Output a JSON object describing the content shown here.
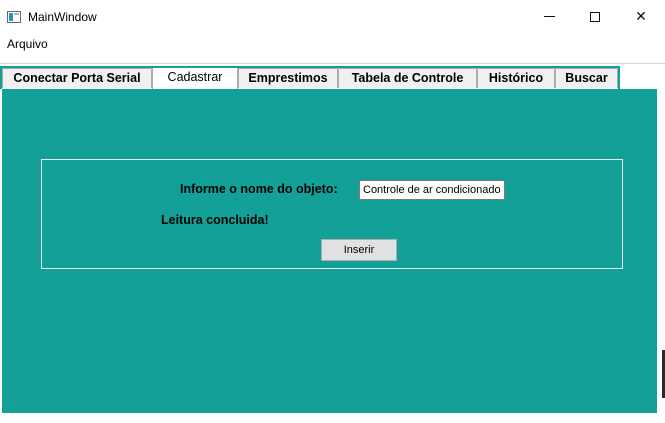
{
  "window": {
    "title": "MainWindow",
    "icon": "app-window-icon",
    "controls": {
      "minimize": "minimize-icon",
      "maximize": "maximize-icon",
      "close_glyph": "✕"
    }
  },
  "menu": {
    "items": [
      {
        "label": "Arquivo"
      }
    ]
  },
  "tabs": [
    {
      "label": "Conectar Porta Serial",
      "active": false
    },
    {
      "label": "Cadastrar",
      "active": true
    },
    {
      "label": "Emprestimos",
      "active": false
    },
    {
      "label": "Tabela de Controle",
      "active": false
    },
    {
      "label": "Histórico",
      "active": false
    },
    {
      "label": "Buscar",
      "active": false
    }
  ],
  "cadastrar": {
    "prompt_label": "Informe o nome do objeto:",
    "object_name_value": "Controle de ar condicionado",
    "status_text": "Leitura concluida!",
    "insert_label": "Inserir"
  },
  "colors": {
    "content_background": "#12a099",
    "groupbox_border": "#e8f6f5"
  }
}
